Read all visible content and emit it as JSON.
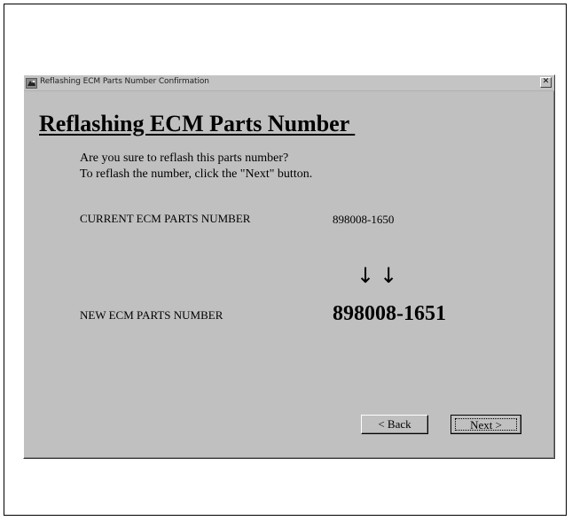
{
  "window": {
    "title": "Reflashing ECM Parts Number Confirmation",
    "close_glyph": "✕"
  },
  "content": {
    "heading": "Reflashing ECM Parts Number ",
    "question_line1": "Are you sure to reflash this parts number?",
    "question_line2": "To reflash the number, click the \"Next\" button.",
    "current_label": "CURRENT ECM PARTS NUMBER",
    "current_value": "898008-1650",
    "arrows": "↓↓",
    "new_label": "NEW ECM PARTS NUMBER",
    "new_value": "898008-1651"
  },
  "buttons": {
    "back_label": "< Back",
    "next_label": "Next >"
  },
  "icons": {
    "title_icon": "app-icon",
    "close_icon": "close-icon"
  }
}
